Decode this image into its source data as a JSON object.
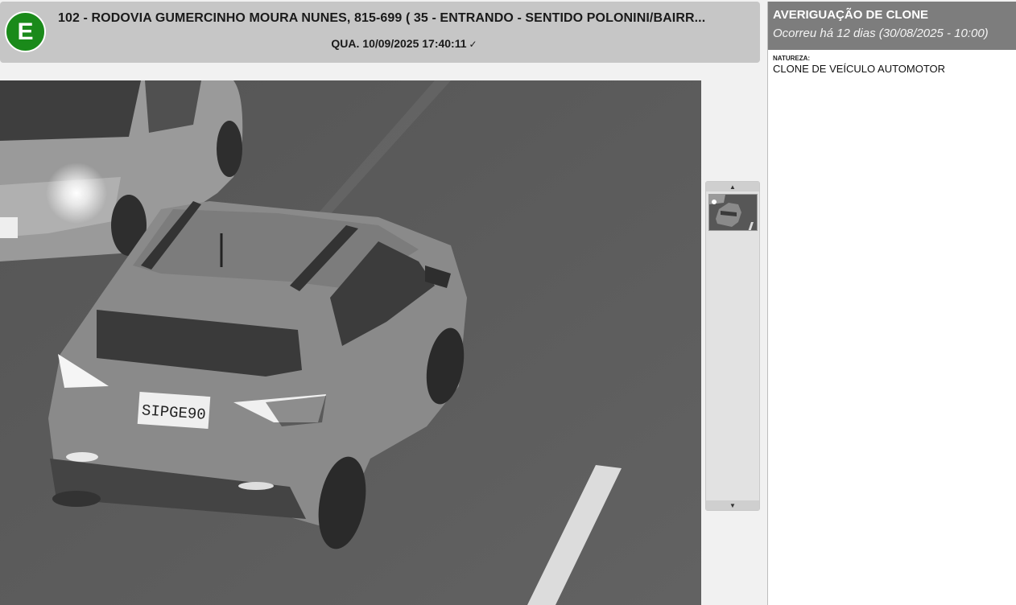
{
  "header": {
    "badge_letter": "E",
    "badge_color": "#1a8a1a",
    "location": "102 - RODOVIA GUMERCINHO MOURA NUNES, 815-699 ( 35 - ENTRANDO - SENTIDO POLONINI/BAIRR...",
    "datetime": "QUA. 10/09/2025 17:40:11",
    "check_icon": "check-icon"
  },
  "camera": {
    "plate_text": "SIPGE90"
  },
  "thumbnails": {
    "up_icon": "caret-up-icon",
    "down_icon": "caret-down-icon"
  },
  "alert": {
    "title": "AVERIGUAÇÃO DE CLONE",
    "subtitle": "Ocorreu há 12 dias (30/08/2025 - 10:00)",
    "natureza_label": "NATUREZA:",
    "natureza_value": "CLONE DE VEÍCULO AUTOMOTOR",
    "header_color": "#7d7d7d"
  }
}
